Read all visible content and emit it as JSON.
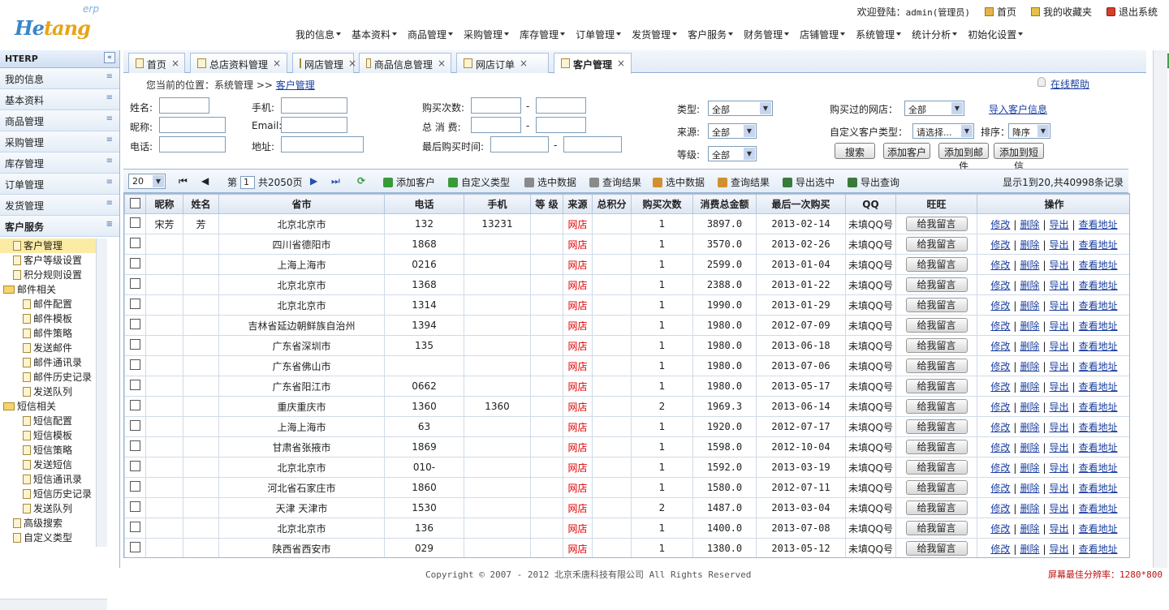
{
  "logo": {
    "main_a": "He",
    "main_b": "tang",
    "sup": "erp"
  },
  "top": {
    "welcome": "欢迎登陆：",
    "user": "admin(管理员)",
    "home": "首页",
    "fav": "我的收藏夹",
    "exit": "退出系统"
  },
  "nav": [
    "我的信息",
    "基本资料",
    "商品管理",
    "采购管理",
    "库存管理",
    "订单管理",
    "发货管理",
    "客户服务",
    "财务管理",
    "店铺管理",
    "系统管理",
    "统计分析",
    "初始化设置"
  ],
  "sidebar": {
    "title": "HTERP",
    "cats": [
      "我的信息",
      "基本资料",
      "商品管理",
      "采购管理",
      "库存管理",
      "订单管理",
      "发货管理",
      "客户服务"
    ],
    "tree": [
      {
        "label": "客户管理",
        "level": 1,
        "type": "doc",
        "selected": true
      },
      {
        "label": "客户等级设置",
        "level": 1,
        "type": "doc"
      },
      {
        "label": "积分规则设置",
        "level": 1,
        "type": "doc"
      },
      {
        "label": "邮件相关",
        "level": 0,
        "type": "folder"
      },
      {
        "label": "邮件配置",
        "level": 2,
        "type": "doc"
      },
      {
        "label": "邮件模板",
        "level": 2,
        "type": "doc"
      },
      {
        "label": "邮件策略",
        "level": 2,
        "type": "doc"
      },
      {
        "label": "发送邮件",
        "level": 2,
        "type": "doc"
      },
      {
        "label": "邮件通讯录",
        "level": 2,
        "type": "doc"
      },
      {
        "label": "邮件历史记录",
        "level": 2,
        "type": "doc"
      },
      {
        "label": "发送队列",
        "level": 2,
        "type": "doc"
      },
      {
        "label": "短信相关",
        "level": 0,
        "type": "folder"
      },
      {
        "label": "短信配置",
        "level": 2,
        "type": "doc"
      },
      {
        "label": "短信模板",
        "level": 2,
        "type": "doc"
      },
      {
        "label": "短信策略",
        "level": 2,
        "type": "doc"
      },
      {
        "label": "发送短信",
        "level": 2,
        "type": "doc"
      },
      {
        "label": "短信通讯录",
        "level": 2,
        "type": "doc"
      },
      {
        "label": "短信历史记录",
        "level": 2,
        "type": "doc"
      },
      {
        "label": "发送队列",
        "level": 2,
        "type": "doc"
      },
      {
        "label": "高级搜索",
        "level": 1,
        "type": "doc"
      },
      {
        "label": "自定义类型",
        "level": 1,
        "type": "doc"
      }
    ]
  },
  "tabs": [
    "首页",
    "总店资料管理",
    "网店管理",
    "商品信息管理",
    "网店订单",
    "客户管理"
  ],
  "crumb": {
    "prefix": "您当前的位置：系统管理 >> ",
    "current": "客户管理",
    "help": "在线帮助"
  },
  "filters": {
    "name": "姓名:",
    "phone": "手机:",
    "buy_count": "购买次数:",
    "type": "类型:",
    "type_val": "全部",
    "shop": "购买过的网店：",
    "shop_val": "全部",
    "import": "导入客户信息",
    "nick": "昵称:",
    "email": "Email:",
    "total": "总 消 费:",
    "source": "来源:",
    "source_val": "全部",
    "custom": "自定义客户类型：",
    "custom_val": "请选择...",
    "sort": "排序：",
    "sort_val": "降序",
    "tel": "电话:",
    "addr": "地址:",
    "last": "最后购买时间:",
    "level": "等级:",
    "level_val": "全部",
    "btn_search": "搜索",
    "btn_add": "添加客户",
    "btn_mail": "添加到邮件",
    "btn_sms": "添加到短信"
  },
  "toolbar": {
    "pagesize": "20",
    "page_prefix": "第",
    "page": "1",
    "page_total": "共2050页",
    "items": [
      "添加客户",
      "自定义类型",
      "选中数据",
      "查询结果",
      "选中数据",
      "查询结果",
      "导出选中",
      "导出查询"
    ],
    "summary": "显示1到20,共40998条记录"
  },
  "grid": {
    "headers": [
      "",
      "昵称",
      "姓名",
      "省市",
      "电话",
      "手机",
      "等 级",
      "来源",
      "总积分",
      "购买次数",
      "消费总金额",
      "最后一次购买",
      "QQ",
      "旺旺",
      "操作"
    ],
    "rows": [
      {
        "nick": "宋芳",
        "name": "芳",
        "city": "北京北京市",
        "tel": "132",
        "mob": "13231",
        "src": "网店",
        "cnt": "1",
        "amt": "3897.0",
        "last": "2013-02-14",
        "qq": "未填QQ号"
      },
      {
        "nick": "",
        "name": "",
        "city": "四川省德阳市",
        "tel": "1868",
        "mob": "",
        "src": "网店",
        "cnt": "1",
        "amt": "3570.0",
        "last": "2013-02-26",
        "qq": "未填QQ号"
      },
      {
        "nick": "",
        "name": "",
        "city": "上海上海市",
        "tel": "0216",
        "mob": "",
        "src": "网店",
        "cnt": "1",
        "amt": "2599.0",
        "last": "2013-01-04",
        "qq": "未填QQ号"
      },
      {
        "nick": "",
        "name": "",
        "city": "北京北京市",
        "tel": "1368",
        "mob": "",
        "src": "网店",
        "cnt": "1",
        "amt": "2388.0",
        "last": "2013-01-22",
        "qq": "未填QQ号"
      },
      {
        "nick": "",
        "name": "",
        "city": "北京北京市",
        "tel": "1314",
        "mob": "",
        "src": "网店",
        "cnt": "1",
        "amt": "1990.0",
        "last": "2013-01-29",
        "qq": "未填QQ号"
      },
      {
        "nick": "",
        "name": "",
        "city": "吉林省延边朝鲜族自治州",
        "tel": "1394",
        "mob": "",
        "src": "网店",
        "cnt": "1",
        "amt": "1980.0",
        "last": "2012-07-09",
        "qq": "未填QQ号"
      },
      {
        "nick": "",
        "name": "",
        "city": "广东省深圳市",
        "tel": "135",
        "mob": "",
        "src": "网店",
        "cnt": "1",
        "amt": "1980.0",
        "last": "2013-06-18",
        "qq": "未填QQ号"
      },
      {
        "nick": "",
        "name": "",
        "city": "广东省佛山市",
        "tel": "",
        "mob": "",
        "src": "网店",
        "cnt": "1",
        "amt": "1980.0",
        "last": "2013-07-06",
        "qq": "未填QQ号"
      },
      {
        "nick": "",
        "name": "",
        "city": "广东省阳江市",
        "tel": "0662",
        "mob": "",
        "src": "网店",
        "cnt": "1",
        "amt": "1980.0",
        "last": "2013-05-17",
        "qq": "未填QQ号"
      },
      {
        "nick": "",
        "name": "",
        "city": "重庆重庆市",
        "tel": "1360",
        "mob": "1360",
        "src": "网店",
        "cnt": "2",
        "amt": "1969.3",
        "last": "2013-06-14",
        "qq": "未填QQ号"
      },
      {
        "nick": "",
        "name": "",
        "city": "上海上海市",
        "tel": "63",
        "mob": "",
        "src": "网店",
        "cnt": "1",
        "amt": "1920.0",
        "last": "2012-07-17",
        "qq": "未填QQ号"
      },
      {
        "nick": "",
        "name": "",
        "city": "甘肃省张掖市",
        "tel": "1869",
        "mob": "",
        "src": "网店",
        "cnt": "1",
        "amt": "1598.0",
        "last": "2012-10-04",
        "qq": "未填QQ号"
      },
      {
        "nick": "",
        "name": "",
        "city": "北京北京市",
        "tel": "010-",
        "mob": "",
        "src": "网店",
        "cnt": "1",
        "amt": "1592.0",
        "last": "2013-03-19",
        "qq": "未填QQ号"
      },
      {
        "nick": "",
        "name": "",
        "city": "河北省石家庄市",
        "tel": "1860",
        "mob": "",
        "src": "网店",
        "cnt": "1",
        "amt": "1580.0",
        "last": "2012-07-11",
        "qq": "未填QQ号"
      },
      {
        "nick": "",
        "name": "",
        "city": "天津 天津市",
        "tel": "1530",
        "mob": "",
        "src": "网店",
        "cnt": "2",
        "amt": "1487.0",
        "last": "2013-03-04",
        "qq": "未填QQ号"
      },
      {
        "nick": "",
        "name": "",
        "city": "北京北京市",
        "tel": "136",
        "mob": "",
        "src": "网店",
        "cnt": "1",
        "amt": "1400.0",
        "last": "2013-07-08",
        "qq": "未填QQ号"
      },
      {
        "nick": "",
        "name": "",
        "city": "陕西省西安市",
        "tel": "029",
        "mob": "",
        "src": "网店",
        "cnt": "1",
        "amt": "1380.0",
        "last": "2013-05-12",
        "qq": "未填QQ号"
      }
    ],
    "ww_btn": "给我留言",
    "ops": [
      "修改",
      "删除",
      "导出",
      "查看地址"
    ]
  },
  "footer": {
    "copyright": "Copyright © 2007 - 2012 北京禾唐科技有限公司 All Rights Reserved",
    "right": "屏幕最佳分辨率：1280*800"
  }
}
